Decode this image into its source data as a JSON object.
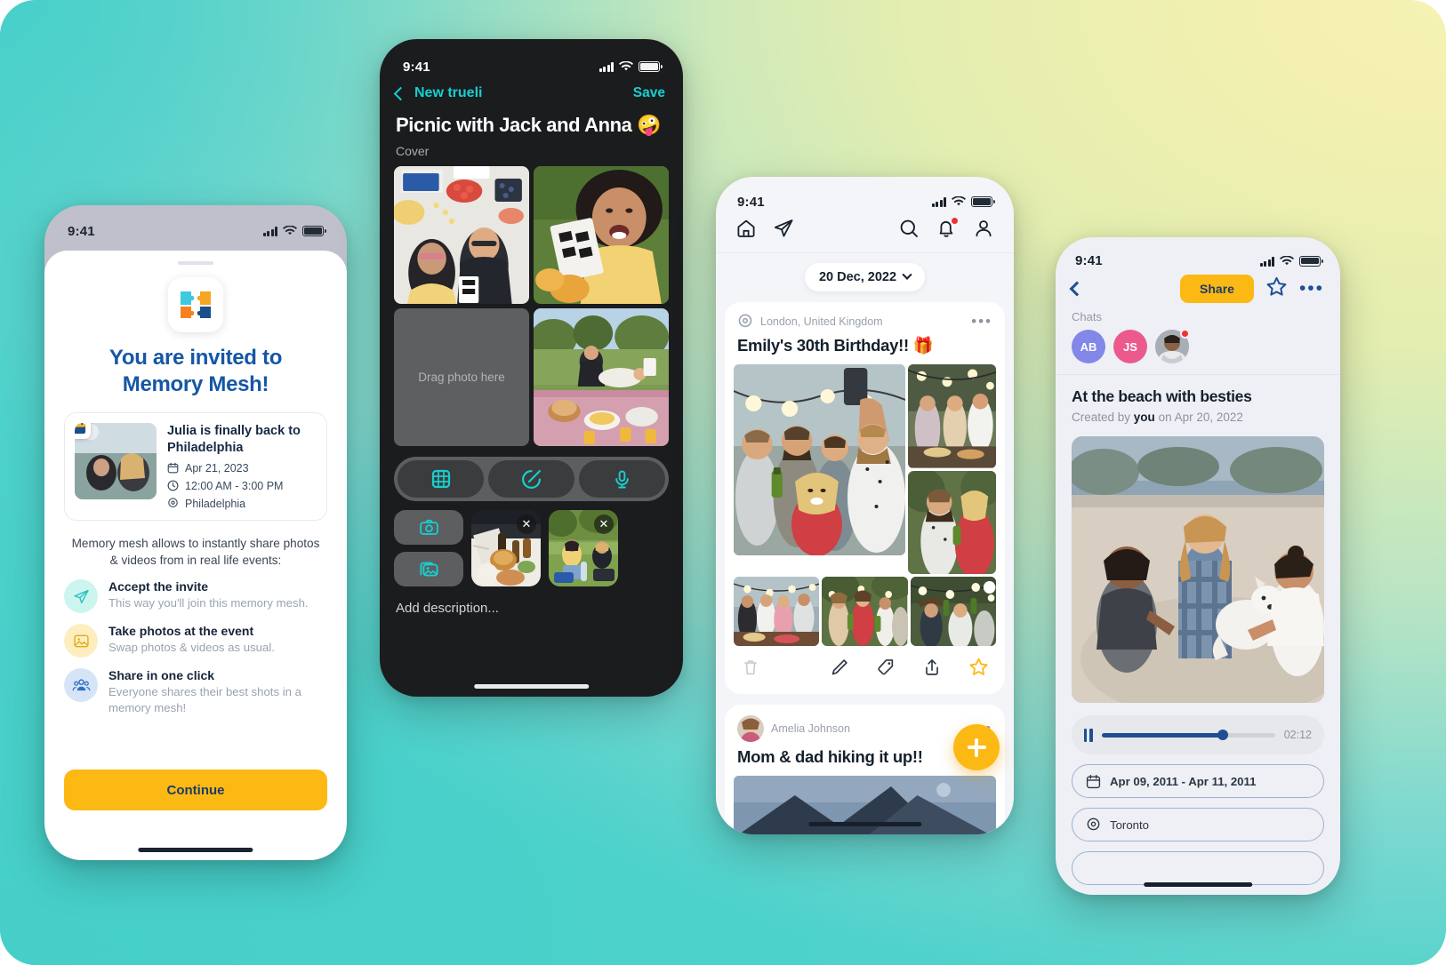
{
  "background": {
    "teal": "#4ed2cb",
    "yellow": "#f5f2b4",
    "green": "#b9e4c4"
  },
  "phone1": {
    "status": {
      "time": "9:41"
    },
    "app_title_line1": "You are invited to",
    "app_title_line2": "Memory Mesh!",
    "event": {
      "name": "Julia is finally back to Philadelphia",
      "date": "Apr 21, 2023",
      "time": "12:00 AM - 3:00 PM",
      "location": "Philadelphia"
    },
    "lead": "Memory mesh allows to instantly share photos & videos from in real life events:",
    "features": [
      {
        "title": "Accept the invite",
        "desc": "This way you'll join this memory mesh.",
        "icon": "send-icon",
        "bg": "#ccf5ef",
        "fg": "#2bbfc0"
      },
      {
        "title": "Take photos at the event",
        "desc": "Swap photos & videos as usual.",
        "icon": "image-icon",
        "bg": "#fdeec0",
        "fg": "#e6a814"
      },
      {
        "title": "Share in one click",
        "desc": "Everyone shares their best shots in a memory mesh!",
        "icon": "people-icon",
        "bg": "#d6e4f8",
        "fg": "#2f6fc4"
      }
    ],
    "cta_label": "Continue"
  },
  "phone2": {
    "status": {
      "time": "9:41"
    },
    "back_label": "New trueli",
    "save_label": "Save",
    "title": "Picnic with Jack and Anna 🤪",
    "cover_label": "Cover",
    "drop_placeholder": "Drag photo here",
    "tools": [
      {
        "name": "grid-icon"
      },
      {
        "name": "sticker-icon"
      },
      {
        "name": "microphone-icon"
      }
    ],
    "attach": [
      {
        "name": "camera-icon"
      },
      {
        "name": "gallery-icon"
      }
    ],
    "thumb_remove_label": "✕",
    "description_placeholder": "Add description..."
  },
  "phone3": {
    "status": {
      "time": "9:41"
    },
    "nav": {
      "home": "home-icon",
      "send": "send-icon",
      "search": "search-icon",
      "bell": "bell-icon",
      "profile": "profile-icon"
    },
    "date_filter": "20 Dec, 2022",
    "posts": [
      {
        "location": "London, United Kingdom",
        "title": "Emily's 30th Birthday!! 🎁",
        "menu": "•••",
        "actions": [
          "trash-icon",
          "edit-icon",
          "tag-icon",
          "share-icon",
          "star-icon"
        ]
      },
      {
        "author": "Amelia Johnson",
        "title": "Mom & dad hiking it up!!",
        "menu": "•••"
      }
    ],
    "fab": "add-icon"
  },
  "phone4": {
    "status": {
      "time": "9:41"
    },
    "share_label": "Share",
    "chats_label": "Chats",
    "chips": [
      {
        "label": "AB",
        "color": "#8287e8"
      },
      {
        "label": "JS",
        "color": "#ec5a8d"
      },
      {
        "label": "",
        "color": "#b9bec6",
        "photo": true,
        "badge": true
      }
    ],
    "title": "At the beach with besties",
    "created_prefix": "Created by ",
    "created_by": "you",
    "created_suffix": " on Apr 20, 2022",
    "player": {
      "time": "02:12",
      "progress_percent": 70
    },
    "date_range": "Apr 09, 2011  -  Apr 11, 2011",
    "location": "Toronto"
  }
}
